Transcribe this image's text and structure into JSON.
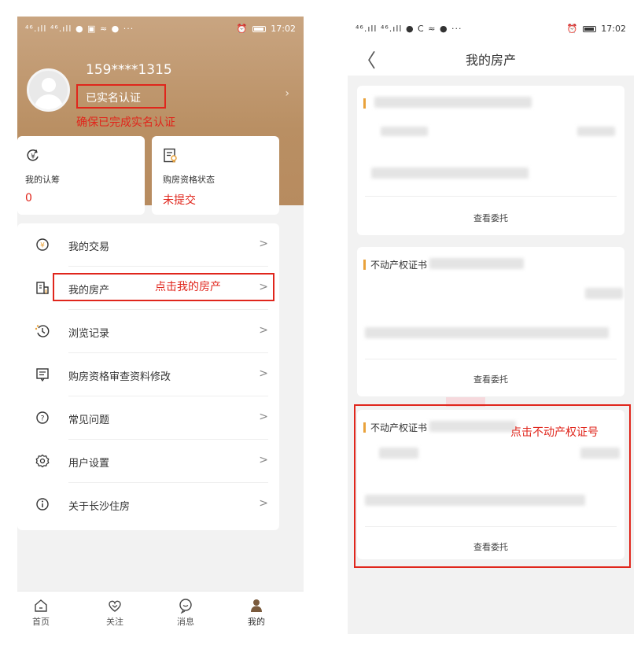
{
  "left": {
    "status": {
      "signal": "⁴⁶.ıll ⁴⁶.ıll ● ▣ ≈ ● ···",
      "time": "17:02"
    },
    "profile": {
      "phone": "159****1315",
      "verified": "已实名认证",
      "arrow": "›"
    },
    "annotations": {
      "realname": "确保已完成实名认证",
      "click_mine": "点击我的房产"
    },
    "cards": [
      {
        "title": "我的认筹",
        "value": "0",
        "icon": "yuan-refresh-icon"
      },
      {
        "title": "购房资格状态",
        "value": "未提交",
        "icon": "certificate-icon"
      }
    ],
    "menu": [
      {
        "label": "我的交易",
        "icon": "yuan-circle-icon"
      },
      {
        "label": "我的房产",
        "icon": "building-icon"
      },
      {
        "label": "浏览记录",
        "icon": "history-icon"
      },
      {
        "label": "购房资格审查资料修改",
        "icon": "edit-doc-icon"
      },
      {
        "label": "常见问题",
        "icon": "question-icon"
      },
      {
        "label": "用户设置",
        "icon": "gear-icon"
      },
      {
        "label": "关于长沙住房",
        "icon": "info-icon"
      }
    ],
    "menu_arrow": ">",
    "tabs": [
      {
        "label": "首页",
        "icon": "home-icon"
      },
      {
        "label": "关注",
        "icon": "heart-icon"
      },
      {
        "label": "消息",
        "icon": "message-icon"
      },
      {
        "label": "我的",
        "icon": "user-icon"
      }
    ],
    "colors": {
      "brand": "#b98f63",
      "annotation": "#e0261c",
      "accent_bar": "#e9a23b"
    }
  },
  "right": {
    "status": {
      "signal": "⁴⁶.ıll ⁴⁶.ıll ● C ≈ ● ···",
      "time": "17:02"
    },
    "nav": {
      "back": "〈",
      "title": "我的房产"
    },
    "cards": [
      {
        "head": "",
        "footer": "查看委托"
      },
      {
        "head": "不动产权证书",
        "footer": "查看委托"
      },
      {
        "head": "不动产权证书",
        "footer": "查看委托"
      }
    ],
    "annotation_cert": "点击不动产权证号"
  }
}
